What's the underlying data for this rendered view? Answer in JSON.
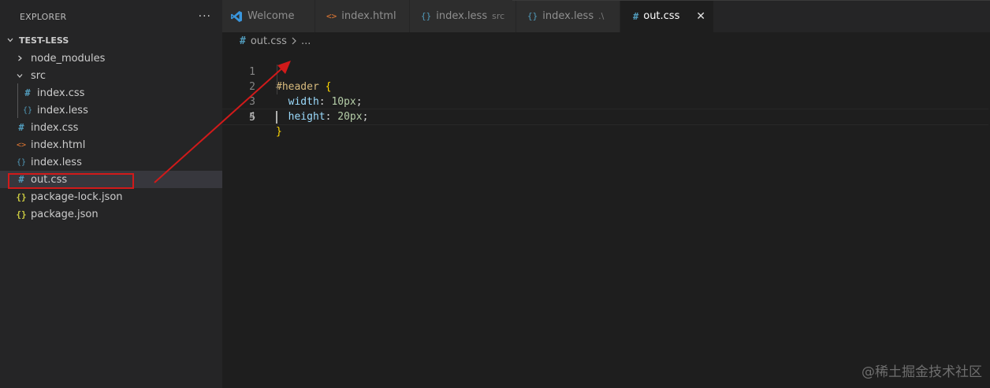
{
  "sidebar": {
    "title": "EXPLORER",
    "more_label": "···",
    "project": "TEST-LESS",
    "items": [
      {
        "label": "node_modules",
        "icon": "chevron-right-icon",
        "glyph": "›"
      },
      {
        "label": "src",
        "icon": "chevron-down-icon",
        "glyph": "⌄"
      },
      {
        "label": "index.css",
        "icon": "css-file-icon",
        "glyph": "#"
      },
      {
        "label": "index.less",
        "icon": "less-file-icon",
        "glyph": "{}"
      },
      {
        "label": "index.css",
        "icon": "css-file-icon",
        "glyph": "#"
      },
      {
        "label": "index.html",
        "icon": "html-file-icon",
        "glyph": "<>"
      },
      {
        "label": "index.less",
        "icon": "less-file-icon",
        "glyph": "{}"
      },
      {
        "label": "out.css",
        "icon": "css-file-icon",
        "glyph": "#"
      },
      {
        "label": "package-lock.json",
        "icon": "json-file-icon",
        "glyph": "{}"
      },
      {
        "label": "package.json",
        "icon": "json-file-icon",
        "glyph": "{}"
      }
    ]
  },
  "tabs": [
    {
      "label": "Welcome",
      "glyph": "",
      "desc": ""
    },
    {
      "label": "index.html",
      "glyph": "<>",
      "desc": ""
    },
    {
      "label": "index.less",
      "glyph": "{}",
      "desc": "src"
    },
    {
      "label": "index.less",
      "glyph": "{}",
      "desc": ".\\"
    },
    {
      "label": "out.css",
      "glyph": "#",
      "desc": "",
      "close": "✕"
    }
  ],
  "breadcrumb": {
    "file": "out.css",
    "glyph": "#",
    "more": "..."
  },
  "editor": {
    "lines": [
      {
        "n": "1",
        "tokens": [
          [
            "sel",
            "#header"
          ],
          [
            "punc",
            " "
          ],
          [
            "brace",
            "{"
          ]
        ]
      },
      {
        "n": "2",
        "tokens": [
          [
            "punc",
            "  "
          ],
          [
            "prop",
            "width"
          ],
          [
            "punc",
            ": "
          ],
          [
            "num",
            "10px"
          ],
          [
            "punc",
            ";"
          ]
        ]
      },
      {
        "n": "3",
        "tokens": [
          [
            "punc",
            "  "
          ],
          [
            "prop",
            "height"
          ],
          [
            "punc",
            ": "
          ],
          [
            "num",
            "20px"
          ],
          [
            "punc",
            ";"
          ]
        ]
      },
      {
        "n": "4",
        "tokens": [
          [
            "brace",
            "}"
          ]
        ]
      },
      {
        "n": "5",
        "tokens": []
      }
    ]
  },
  "colors": {
    "annotation": "#d11a1a",
    "css_icon": "#519aba",
    "html_icon": "#e37933",
    "json_icon": "#cbcb41"
  },
  "watermark": "@稀土掘金技术社区"
}
